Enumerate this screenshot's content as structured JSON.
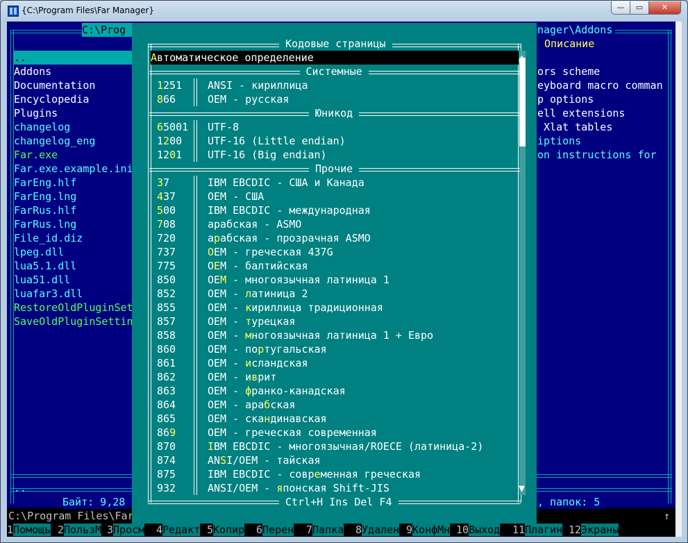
{
  "window": {
    "title": "{C:\\Program Files\\Far Manager}",
    "controls": [
      "—",
      "▭",
      "✕"
    ]
  },
  "left_panel": {
    "path": "C:\\Prog",
    "rows": [
      {
        "name": "..",
        "color": "#ffffff",
        "selected": true
      },
      {
        "name": "Addons",
        "color": "#ffffff"
      },
      {
        "name": "Documentation",
        "color": "#ffffff"
      },
      {
        "name": "Encyclopedia",
        "color": "#ffffff"
      },
      {
        "name": "Plugins",
        "color": "#ffffff"
      },
      {
        "name": "changelog",
        "color": "#55ffff"
      },
      {
        "name": "changelog_eng",
        "color": "#55ffff"
      },
      {
        "name": "Far.exe",
        "color": "#55ff55"
      },
      {
        "name": "Far.exe.example.ini",
        "color": "#55ffff"
      },
      {
        "name": "FarEng.hlf",
        "color": "#55ffff"
      },
      {
        "name": "FarEng.lng",
        "color": "#55ffff"
      },
      {
        "name": "FarRus.hlf",
        "color": "#55ffff"
      },
      {
        "name": "FarRus.lng",
        "color": "#55ffff"
      },
      {
        "name": "File_id.diz",
        "color": "#55ffff"
      },
      {
        "name": "lpeg.dll",
        "color": "#55ffff"
      },
      {
        "name": "lua5.1.dll",
        "color": "#55ffff"
      },
      {
        "name": "lua51.dll",
        "color": "#55ffff"
      },
      {
        "name": "luafar3.dll",
        "color": "#55ffff"
      },
      {
        "name": "RestoreOldPluginSet",
        "color": "#55ff55"
      },
      {
        "name": "SaveOldPluginSettin",
        "color": "#55ff55"
      }
    ],
    "status_name": "..",
    "bytes_label": "Байт: 9,28"
  },
  "right_panel": {
    "path": "nager\\Addons",
    "column_header": "Описание",
    "rows": [
      {
        "text": "ors scheme",
        "color": "#ffffff"
      },
      {
        "text": "eyboard macro comman",
        "color": "#ffffff"
      },
      {
        "text": "p options",
        "color": "#ffffff"
      },
      {
        "text": "ell extensions",
        "color": "#ffffff"
      },
      {
        "text": " Xlat tables",
        "color": "#ffffff"
      },
      {
        "text": "iptions",
        "color": "#55ffff"
      },
      {
        "text": "on instructions for",
        "color": "#55ffff"
      }
    ],
    "folders_label": ", папок: 5"
  },
  "command_line": "C:\\Program Files\\Far",
  "cmd_scroll_glyph": "↑",
  "keybar": [
    {
      "num": "1",
      "label": "Помощь"
    },
    {
      "num": "2",
      "label": "ПользМ"
    },
    {
      "num": "3",
      "label": "Просм"
    },
    {
      "num": "4",
      "label": "Редакт"
    },
    {
      "num": "5",
      "label": "Копир"
    },
    {
      "num": "6",
      "label": "Перен"
    },
    {
      "num": "7",
      "label": "Папка"
    },
    {
      "num": "8",
      "label": "Удален"
    },
    {
      "num": "9",
      "label": "КонфМн"
    },
    {
      "num": "10",
      "label": "Выход"
    },
    {
      "num": "11",
      "label": "Плагин"
    },
    {
      "num": "12",
      "label": "Экраны"
    }
  ],
  "dialog": {
    "title": " Кодовые страницы ",
    "footer": " Ctrl+H Ins Del F4 ",
    "scroll_up": "▲",
    "scroll_down": "▼",
    "items": [
      {
        "type": "selected",
        "hot": "А",
        "rest": "втоматическое определение"
      },
      {
        "type": "sep",
        "title": " Системные "
      },
      {
        "type": "item",
        "pre": "",
        "hot": "1",
        "post": "251",
        "desc_pre": "ANSI - кириллица",
        "desc_hot": "",
        "desc_post": ""
      },
      {
        "type": "item",
        "pre": "",
        "hot": "8",
        "post": "66",
        "desc_pre": "OEM - русская",
        "desc_hot": "",
        "desc_post": ""
      },
      {
        "type": "sep",
        "title": " Юникод "
      },
      {
        "type": "item",
        "pre": "",
        "hot": "6",
        "post": "5001",
        "desc_pre": "UTF-8",
        "desc_hot": "",
        "desc_post": ""
      },
      {
        "type": "item",
        "pre": "1",
        "hot": "2",
        "post": "00",
        "desc_pre": "UTF-16 (Little endian)",
        "desc_hot": "",
        "desc_post": ""
      },
      {
        "type": "item",
        "pre": "12",
        "hot": "0",
        "post": "1",
        "desc_pre": "UTF-16 (Big endian)",
        "desc_hot": "",
        "desc_post": ""
      },
      {
        "type": "sep",
        "title": " Прочие "
      },
      {
        "type": "item",
        "pre": "",
        "hot": "3",
        "post": "7",
        "desc_pre": "IBM EBCDIC - США и Канада",
        "desc_hot": "",
        "desc_post": ""
      },
      {
        "type": "item",
        "pre": "",
        "hot": "4",
        "post": "37",
        "desc_pre": "OEM - США",
        "desc_hot": "",
        "desc_post": ""
      },
      {
        "type": "item",
        "pre": "",
        "hot": "5",
        "post": "00",
        "desc_pre": "IBM EBCDIC - международная",
        "desc_hot": "",
        "desc_post": ""
      },
      {
        "type": "item",
        "pre": "",
        "hot": "7",
        "post": "08",
        "desc_pre": "арабская - ASMO",
        "desc_hot": "",
        "desc_post": ""
      },
      {
        "type": "item",
        "pre": "720",
        "hot": "",
        "post": "",
        "desc_pre": "а",
        "desc_hot": "р",
        "desc_post": "абская - прозрачная ASMO"
      },
      {
        "type": "item",
        "pre": "737",
        "hot": "",
        "post": "",
        "desc_pre": "",
        "desc_hot": "O",
        "desc_post": "EM - греческая 437G"
      },
      {
        "type": "item",
        "pre": "775",
        "hot": "",
        "post": "",
        "desc_pre": "O",
        "desc_hot": "E",
        "desc_post": "M - балтийская"
      },
      {
        "type": "item",
        "pre": "850",
        "hot": "",
        "post": "",
        "desc_pre": "OE",
        "desc_hot": "M",
        "desc_post": " - многоязычная латиница 1"
      },
      {
        "type": "item",
        "pre": "852",
        "hot": "",
        "post": "",
        "desc_pre": "OEM - ",
        "desc_hot": "л",
        "desc_post": "атиница 2"
      },
      {
        "type": "item",
        "pre": "855",
        "hot": "",
        "post": "",
        "desc_pre": "OEM - ",
        "desc_hot": "к",
        "desc_post": "ириллица традиционная"
      },
      {
        "type": "item",
        "pre": "857",
        "hot": "",
        "post": "",
        "desc_pre": "OEM - ",
        "desc_hot": "т",
        "desc_post": "урецкая"
      },
      {
        "type": "item",
        "pre": "858",
        "hot": "",
        "post": "",
        "desc_pre": "OEM - ",
        "desc_hot": "м",
        "desc_post": "ногоязычная латиница 1 + Евро"
      },
      {
        "type": "item",
        "pre": "860",
        "hot": "",
        "post": "",
        "desc_pre": "OEM - по",
        "desc_hot": "р",
        "desc_post": "тугальская"
      },
      {
        "type": "item",
        "pre": "861",
        "hot": "",
        "post": "",
        "desc_pre": "OEM - ",
        "desc_hot": "и",
        "desc_post": "сландская"
      },
      {
        "type": "item",
        "pre": "862",
        "hot": "",
        "post": "",
        "desc_pre": "OEM - и",
        "desc_hot": "в",
        "desc_post": "рит"
      },
      {
        "type": "item",
        "pre": "863",
        "hot": "",
        "post": "",
        "desc_pre": "OEM - ",
        "desc_hot": "ф",
        "desc_post": "ранко-канадская"
      },
      {
        "type": "item",
        "pre": "864",
        "hot": "",
        "post": "",
        "desc_pre": "OEM - ара",
        "desc_hot": "б",
        "desc_post": "ская"
      },
      {
        "type": "item",
        "pre": "865",
        "hot": "",
        "post": "",
        "desc_pre": "OEM - ска",
        "desc_hot": "н",
        "desc_post": "динавская"
      },
      {
        "type": "item",
        "pre": "86",
        "hot": "9",
        "post": "",
        "desc_pre": "OEM - греческая современная",
        "desc_hot": "",
        "desc_post": ""
      },
      {
        "type": "item",
        "pre": "870",
        "hot": "",
        "post": "",
        "desc_pre": "",
        "desc_hot": "I",
        "desc_post": "BM EBCDIC - многоязычная/ROECE (латиница-2)"
      },
      {
        "type": "item",
        "pre": "874",
        "hot": "",
        "post": "",
        "desc_pre": "AN",
        "desc_hot": "S",
        "desc_post": "I/OEM - тайская"
      },
      {
        "type": "item",
        "pre": "875",
        "hot": "",
        "post": "",
        "desc_pre": "IBM EBCDIC - совр",
        "desc_hot": "е",
        "desc_post": "менная греческая"
      },
      {
        "type": "item",
        "pre": "932",
        "hot": "",
        "post": "",
        "desc_pre": "ANSI/OEM - ",
        "desc_hot": "я",
        "desc_post": "понская Shift-JIS"
      }
    ]
  },
  "colors": {
    "panel_bg": "#000080",
    "panel_border": "#00aaaa",
    "dialog_bg": "#008080",
    "dialog_border": "#ffffff",
    "hotkey": "#ffff55",
    "keybar_bg": "#008080",
    "cmd_text": "#c0c0c0"
  }
}
